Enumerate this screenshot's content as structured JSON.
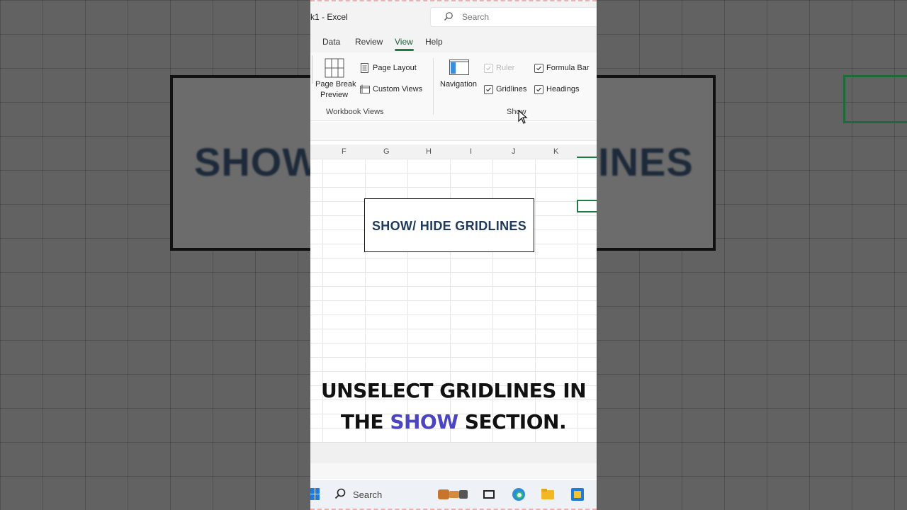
{
  "window": {
    "title": "k1 - Excel",
    "search_placeholder": "Search"
  },
  "tabs": [
    {
      "label": "Data"
    },
    {
      "label": "Review"
    },
    {
      "label": "View",
      "active": true
    },
    {
      "label": "Help"
    }
  ],
  "ribbon": {
    "page_break_preview": "Page Break",
    "page_break_preview_2": "Preview",
    "page_layout": "Page Layout",
    "custom_views": "Custom Views",
    "workbook_views_label": "Workbook Views",
    "navigation": "Navigation",
    "ruler": "Ruler",
    "formula_bar": "Formula Bar",
    "gridlines": "Gridlines",
    "headings": "Headings",
    "show_label": "Show",
    "checkboxes": {
      "ruler_checked": true,
      "ruler_disabled": true,
      "formula_bar_checked": true,
      "gridlines_checked": true,
      "headings_checked": true
    }
  },
  "columns": [
    "F",
    "G",
    "H",
    "I",
    "J",
    "K"
  ],
  "textbox": "SHOW/ HIDE GRIDLINES",
  "caption": {
    "line1": "UNSELECT GRIDLINES IN",
    "line2_a": "THE ",
    "line2_highlight": "SHOW",
    "line2_b": " SECTION."
  },
  "taskbar": {
    "search_label": "Search"
  },
  "background": {
    "left_text": "SHOW",
    "right_text": "INES"
  },
  "colors": {
    "excel_green": "#1e7b46",
    "highlight": "#4b45c2"
  }
}
